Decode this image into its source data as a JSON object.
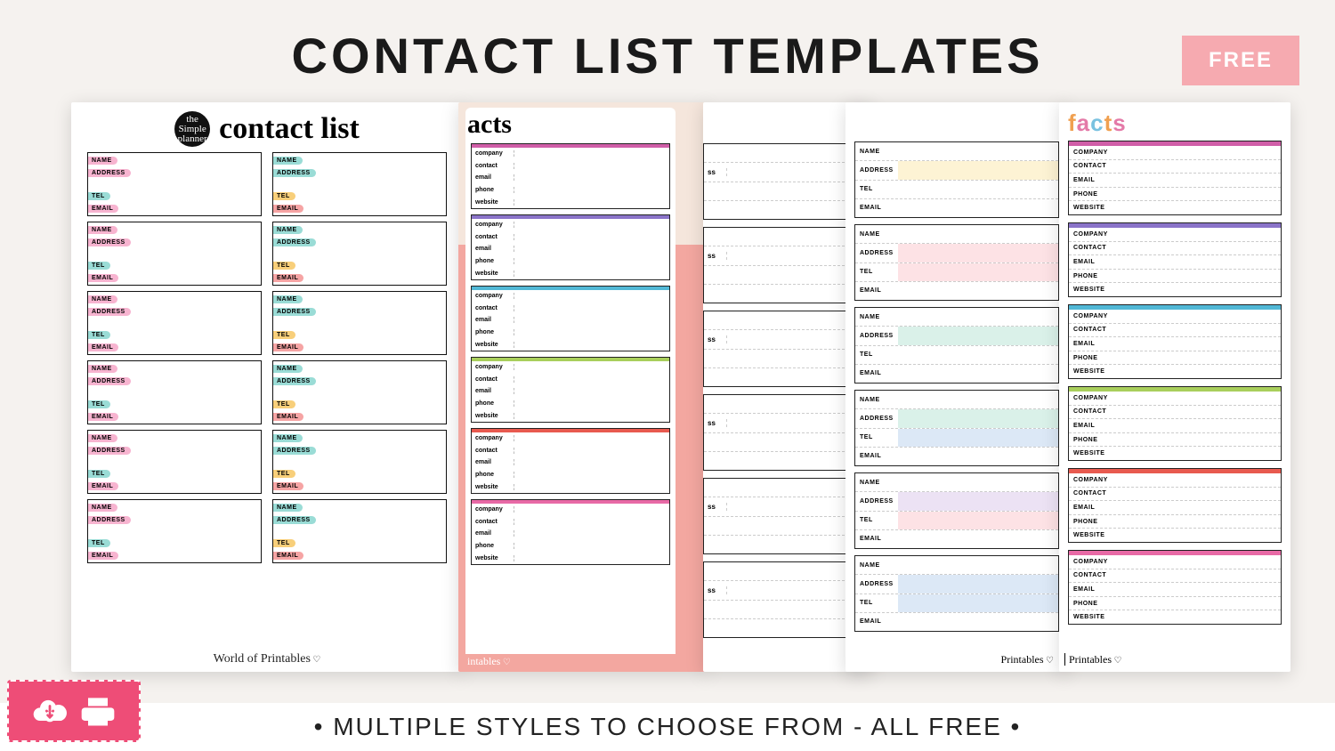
{
  "header": {
    "title": "CONTACT LIST TEMPLATES",
    "free_badge": "FREE"
  },
  "template1": {
    "logo_text": "the Simple planner",
    "title": "contact list",
    "fields": {
      "name": "NAME",
      "address": "ADDRESS",
      "tel": "TEL",
      "email": "EMAIL"
    },
    "card_count_per_col": 6,
    "footer": "World of Printables"
  },
  "template2": {
    "title_partial": "acts",
    "fields": {
      "company": "company",
      "contact": "contact",
      "email": "email",
      "phone": "phone",
      "website": "website"
    },
    "bar_colors": [
      "c-mag",
      "c-pur",
      "c-cyan",
      "c-grn",
      "c-red",
      "c-pink"
    ],
    "footer": "intables"
  },
  "template3": {
    "field_partial": "ss",
    "card_count": 6
  },
  "template4": {
    "fields": {
      "name": "NAME",
      "address": "ADDRESS",
      "tel": "TEL",
      "email": "EMAIL"
    },
    "fill_sets": [
      [
        "",
        "p4-yel",
        "",
        ""
      ],
      [
        "",
        "p4-pk",
        "p4-pk",
        ""
      ],
      [
        "",
        "p4-mn",
        "",
        ""
      ],
      [
        "",
        "p4-mn",
        "p4-bl",
        ""
      ],
      [
        "",
        "p4-lv",
        "p4-pk",
        ""
      ],
      [
        "",
        "p4-bl",
        "p4-bl",
        ""
      ]
    ],
    "footer": "Printables"
  },
  "template5": {
    "title_chars": [
      "f",
      "a",
      "c",
      "t",
      "s"
    ],
    "fields": {
      "company": "COMPANY",
      "contact": "CONTACT",
      "email": "EMAIL",
      "phone": "PHONE",
      "website": "WEBSITE"
    },
    "bar_colors": [
      "c-mag",
      "c-pur",
      "c-cyan",
      "c-grn",
      "c-red",
      "c-pink"
    ],
    "footer": "Printables"
  },
  "bottom": {
    "tagline": "• MULTIPLE STYLES TO CHOOSE FROM - ALL FREE •"
  }
}
